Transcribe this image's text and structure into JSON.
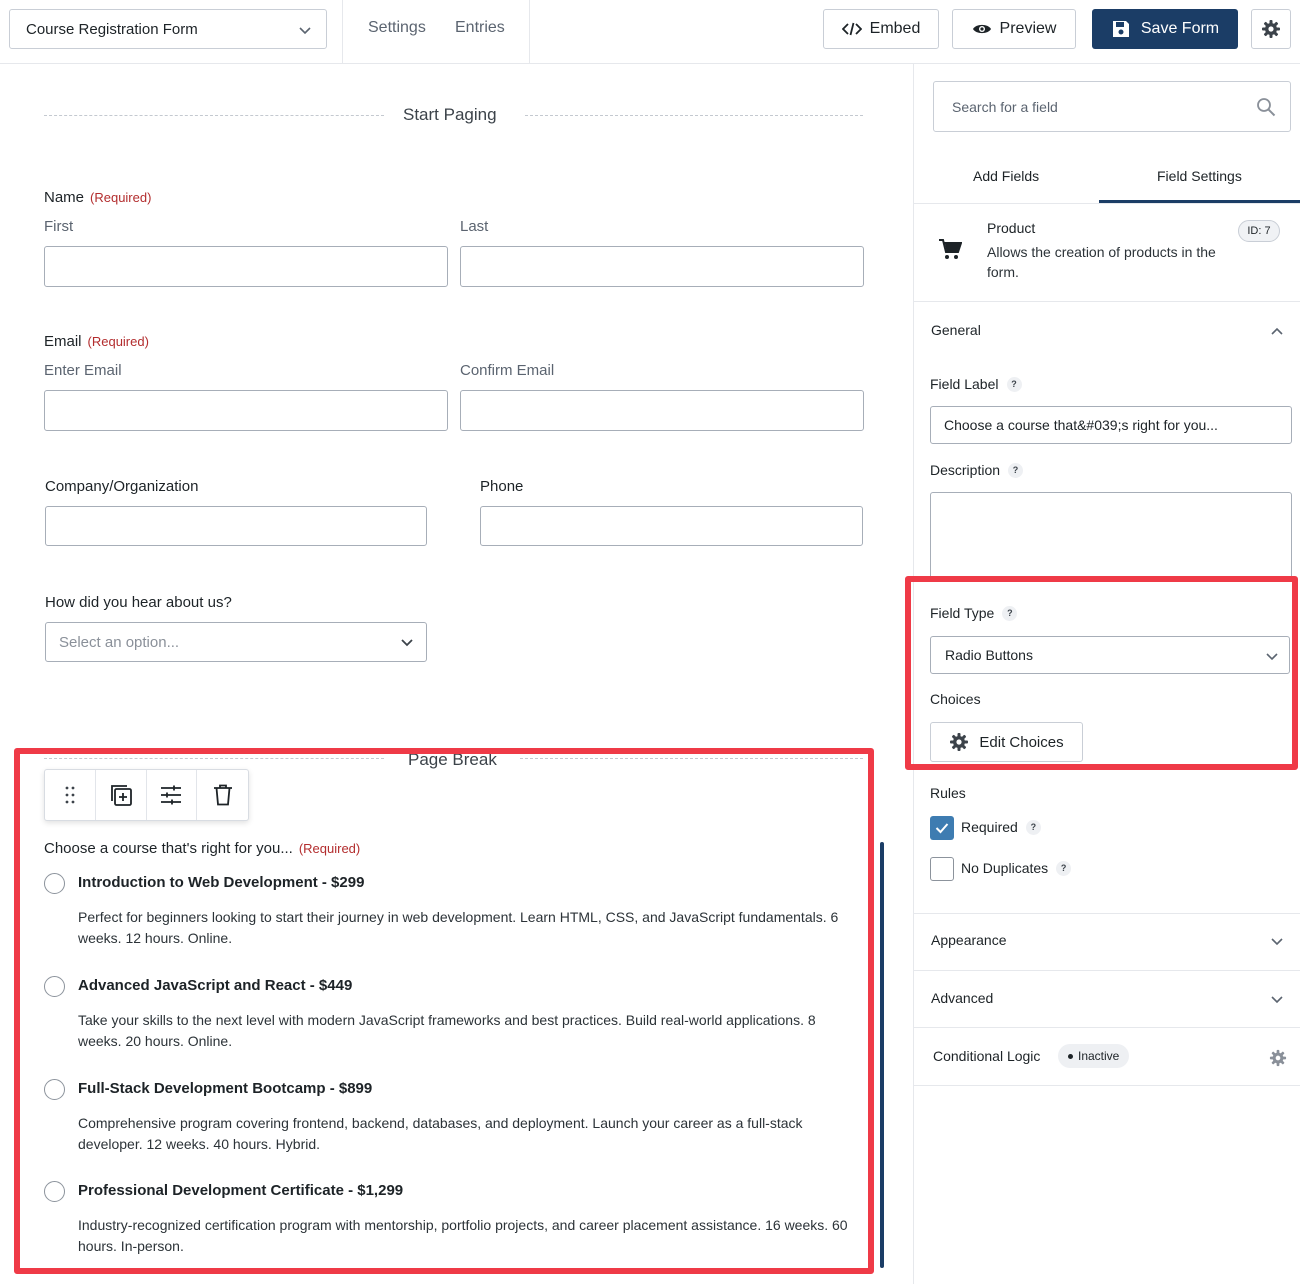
{
  "topbar": {
    "form_name": "Course Registration Form",
    "links": {
      "settings": "Settings",
      "entries": "Entries"
    },
    "embed_label": "Embed",
    "preview_label": "Preview",
    "save_label": "Save Form"
  },
  "canvas": {
    "start_paging": "Start Paging",
    "page_break": "Page Break",
    "required_text": "(Required)",
    "name": {
      "label": "Name",
      "first": "First",
      "last": "Last"
    },
    "email": {
      "label": "Email",
      "enter": "Enter Email",
      "confirm": "Confirm Email"
    },
    "company": {
      "label": "Company/Organization"
    },
    "phone": {
      "label": "Phone"
    },
    "hear": {
      "label": "How did you hear about us?",
      "placeholder": "Select an option..."
    },
    "course": {
      "label": "Choose a course that's right for you...",
      "choices": [
        {
          "label": "Introduction to Web Development - $299",
          "desc": "Perfect for beginners looking to start their journey in web development. Learn HTML, CSS, and JavaScript fundamentals. 6 weeks. 12 hours. Online."
        },
        {
          "label": "Advanced JavaScript and React - $449",
          "desc": "Take your skills to the next level with modern JavaScript frameworks and best practices. Build real-world applications. 8 weeks. 20 hours. Online."
        },
        {
          "label": "Full-Stack Development Bootcamp - $899",
          "desc": "Comprehensive program covering frontend, backend, databases, and deployment. Launch your career as a full-stack developer. 12 weeks. 40 hours. Hybrid."
        },
        {
          "label": "Professional Development Certificate - $1,299",
          "desc": "Industry-recognized certification program with mentorship, portfolio projects, and career placement assistance. 16 weeks. 60 hours. In-person."
        }
      ]
    }
  },
  "panel": {
    "search_placeholder": "Search for a field",
    "tabs": {
      "add": "Add Fields",
      "settings": "Field Settings"
    },
    "product": {
      "title": "Product",
      "desc": "Allows the creation of products in the form.",
      "id": "ID: 7"
    },
    "general": "General",
    "field_label": {
      "label": "Field Label",
      "value": "Choose a course that&#039;s right for you..."
    },
    "description_label": "Description",
    "field_type": {
      "label": "Field Type",
      "value": "Radio Buttons"
    },
    "choices_label": "Choices",
    "edit_choices": "Edit Choices",
    "rules": {
      "label": "Rules",
      "required": "Required",
      "no_duplicates": "No Duplicates"
    },
    "appearance": "Appearance",
    "advanced": "Advanced",
    "conditional_logic": {
      "label": "Conditional Logic",
      "status": "Inactive"
    },
    "help_mark": "?"
  },
  "colors": {
    "primary": "#1b3d66",
    "highlight": "#ef3a47",
    "required": "#b32d2e",
    "checkbox": "#3e7cb1"
  }
}
